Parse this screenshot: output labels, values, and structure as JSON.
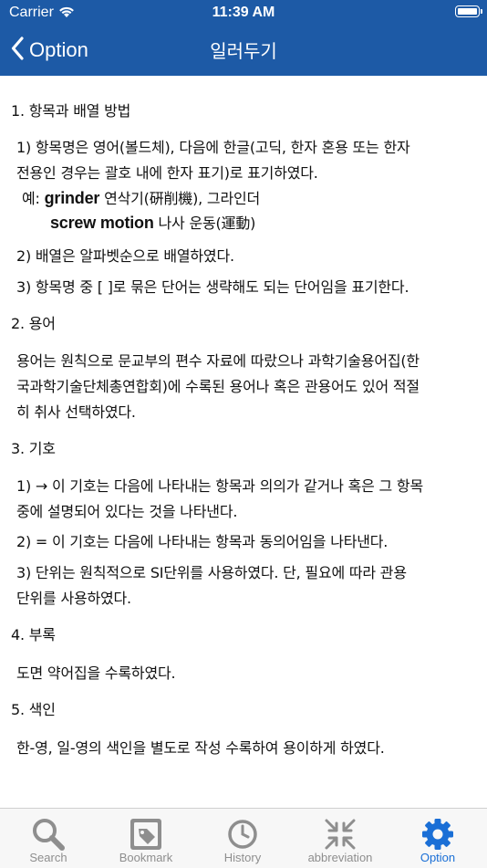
{
  "status_bar": {
    "carrier": "Carrier",
    "time": "11:39 AM"
  },
  "nav": {
    "back_label": "Option",
    "title": "일러두기"
  },
  "content": {
    "s1_heading": "1. 항목과 배열 방법",
    "s1_item1_line1": "1) 항목명은 영어(볼드체), 다음에 한글(고딕, 한자 혼용 또는 한자",
    "s1_item1_line2": "전용인 경우는 괄호 내에 한자 표기)로 표기하였다.",
    "example_prefix": "예:",
    "example1_en": "grinder",
    "example1_ko": "연삭기(硏削機), 그라인더",
    "example2_en": "screw motion",
    "example2_ko": "나사 운동(運動)",
    "s1_item2": "2) 배열은 알파벳순으로 배열하였다.",
    "s1_item3": "3) 항목명 중 [ ]로 묶은 단어는 생략해도 되는 단어임을 표기한다.",
    "s2_heading": "2. 용어",
    "s2_line1": "용어는 원칙으로 문교부의 편수 자료에 따랐으나 과학기술용어집(한",
    "s2_line2": "국과학기술단체총연합회)에 수록된 용어나 혹은 관용어도 있어 적절",
    "s2_line3": "히 취사 선택하였다.",
    "s3_heading": "3. 기호",
    "s3_item1_line1": "1) → 이 기호는 다음에 나타내는 항목과 의의가 같거나 혹은 그 항목",
    "s3_item1_line2": "중에 설명되어 있다는 것을 나타낸다.",
    "s3_item2": "2) = 이 기호는 다음에 나타내는 항목과 동의어임을 나타낸다.",
    "s3_item3_line1": "3) 단위는 원칙적으로 SI단위를 사용하였다. 단, 필요에 따라 관용",
    "s3_item3_line2": "단위를 사용하였다.",
    "s4_heading": "4. 부록",
    "s4_line1": "도면 약어집을 수록하였다.",
    "s5_heading": "5. 색인",
    "s5_line1": "한-영, 일-영의 색인을 별도로 작성 수록하여 용이하게 하였다."
  },
  "tabs": [
    {
      "label": "Search",
      "icon": "search-icon"
    },
    {
      "label": "Bookmark",
      "icon": "bookmark-icon"
    },
    {
      "label": "History",
      "icon": "history-icon"
    },
    {
      "label": "abbreviation",
      "icon": "abbreviation-icon"
    },
    {
      "label": "Option",
      "icon": "gear-icon",
      "active": true
    }
  ],
  "colors": {
    "nav_bar": "#1d5aa6",
    "active_tab": "#1a6fd6",
    "inactive_tab": "#8e8e8e"
  }
}
